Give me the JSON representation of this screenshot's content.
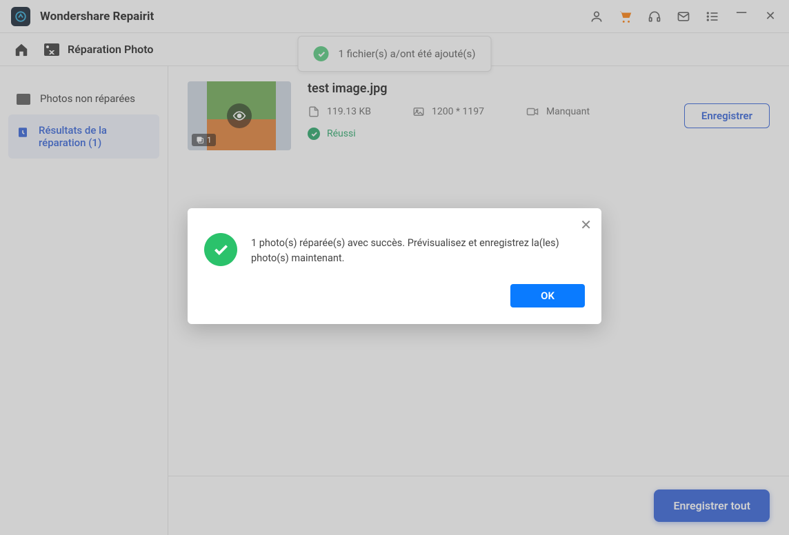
{
  "app": {
    "title": "Wondershare Repairit"
  },
  "breadcrumb": {
    "section": "Réparation Photo"
  },
  "sidebar": {
    "items": [
      {
        "label": "Photos non réparées"
      },
      {
        "label": "Résultats de la réparation (1)"
      }
    ]
  },
  "toast": {
    "message": "1 fichier(s) a/ont été ajouté(s)"
  },
  "file": {
    "name": "test image.jpg",
    "size": "119.13  KB",
    "dimensions": "1200 * 1197",
    "device": "Manquant",
    "status": "Réussi",
    "thumb_badge": "1",
    "save_label": "Enregistrer"
  },
  "footer": {
    "save_all": "Enregistrer tout"
  },
  "modal": {
    "message": "1 photo(s) réparée(s) avec succès. Prévisualisez et enregistrez la(les) photo(s) maintenant.",
    "ok": "OK"
  }
}
